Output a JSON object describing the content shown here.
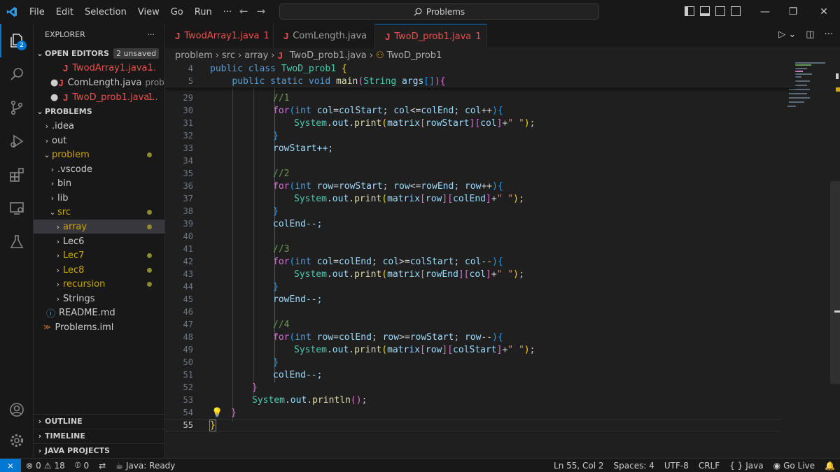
{
  "menu": [
    "File",
    "Edit",
    "Selection",
    "View",
    "Go",
    "Run",
    "···"
  ],
  "command_center": "Problems",
  "window_controls": {
    "minimize": "—",
    "restore": "❐",
    "close": "✕"
  },
  "activity": {
    "explorer_badge": "2"
  },
  "sidebar": {
    "title": "EXPLORER",
    "more": "···",
    "open_editors": {
      "label": "OPEN EDITORS",
      "badge": "2 unsaved",
      "items": [
        {
          "name": "TwodArray1.java...",
          "count": "1",
          "dirty": false
        },
        {
          "name": "ComLength.java",
          "path": "probl...",
          "dirty": true
        },
        {
          "name": "TwoD_prob1.java...",
          "count": "1",
          "dirty": true
        }
      ]
    },
    "folder": "PROBLEMS",
    "tree": [
      {
        "label": ".idea"
      },
      {
        "label": "out"
      },
      {
        "label": "problem"
      },
      {
        "label": ".vscode"
      },
      {
        "label": "bin"
      },
      {
        "label": "lib"
      },
      {
        "label": "src"
      },
      {
        "label": "array"
      },
      {
        "label": "Lec6"
      },
      {
        "label": "Lec7"
      },
      {
        "label": "Lec8"
      },
      {
        "label": "recursion"
      },
      {
        "label": "Strings"
      },
      {
        "label": "README.md"
      },
      {
        "label": "Problems.iml"
      }
    ],
    "bottom": [
      "OUTLINE",
      "TIMELINE",
      "JAVA PROJECTS"
    ]
  },
  "tabs": [
    {
      "label": "TwodArray1.java",
      "count": "1"
    },
    {
      "label": "ComLength.java"
    },
    {
      "label": "TwoD_prob1.java",
      "count": "1"
    }
  ],
  "breadcrumb": [
    "problem",
    "src",
    "array",
    "TwoD_prob1.java",
    "TwoD_prob1"
  ],
  "sticky": [
    {
      "num": "4",
      "text": "public class TwoD_prob1 {"
    },
    {
      "num": "5",
      "text": "    public static void main(String args[]){"
    }
  ],
  "lines": [
    "29",
    "30",
    "31",
    "32",
    "33",
    "34",
    "35",
    "36",
    "37",
    "38",
    "39",
    "40",
    "41",
    "42",
    "43",
    "44",
    "45",
    "46",
    "47",
    "48",
    "49",
    "50",
    "51",
    "52",
    "53",
    "54",
    "55"
  ],
  "code": {
    "c1": "//1",
    "c2": "//2",
    "c3": "//3",
    "c4": "//4",
    "rowStart_inc": "rowStart++;",
    "colEnd_dec": "colEnd--;",
    "rowEnd_dec": "rowEnd--;",
    "colEnd_dec2": "colEnd--;"
  },
  "status": {
    "errors": "0",
    "warnings": "18",
    "ports": "0",
    "java": "Java: Ready",
    "position": "Ln 55, Col 2",
    "spaces": "Spaces: 4",
    "encoding": "UTF-8",
    "eol": "CRLF",
    "language": "Java",
    "golive": "Go Live"
  }
}
